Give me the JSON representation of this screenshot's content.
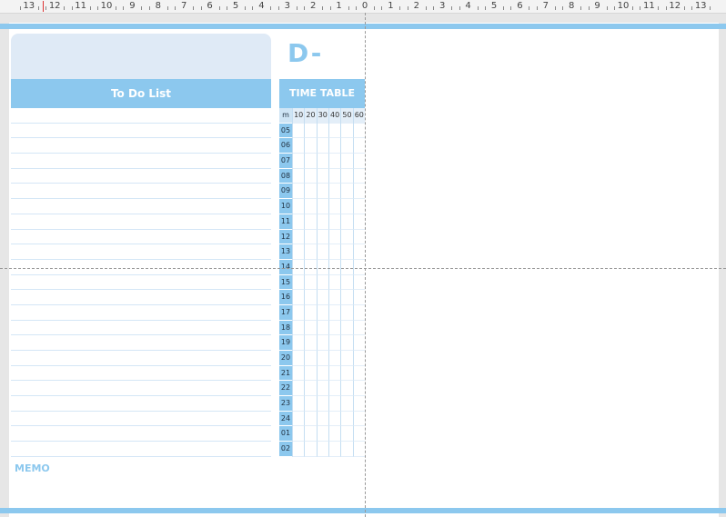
{
  "ruler": {
    "labels": [
      "13",
      "12",
      "11",
      "10",
      "9",
      "8",
      "7",
      "6",
      "5",
      "4",
      "3",
      "2",
      "1",
      "0",
      "1",
      "2",
      "3",
      "4",
      "5",
      "6",
      "7",
      "8",
      "9",
      "10",
      "11",
      "12",
      "13"
    ]
  },
  "planner": {
    "dday_label": "D-",
    "todo": {
      "title": "To Do List",
      "line_count": 23
    },
    "timetable": {
      "title": "TIME TABLE",
      "minute_header": "m",
      "minutes": [
        "10",
        "20",
        "30",
        "40",
        "50",
        "60"
      ],
      "hours": [
        "05",
        "06",
        "07",
        "08",
        "09",
        "10",
        "11",
        "12",
        "13",
        "14",
        "15",
        "16",
        "17",
        "18",
        "19",
        "20",
        "21",
        "22",
        "23",
        "24",
        "01",
        "02"
      ]
    },
    "memo_label": "MEMO"
  },
  "colors": {
    "accent": "#8cc8ee",
    "header_fill": "#dfeaf6",
    "line": "#d4e6f6"
  }
}
